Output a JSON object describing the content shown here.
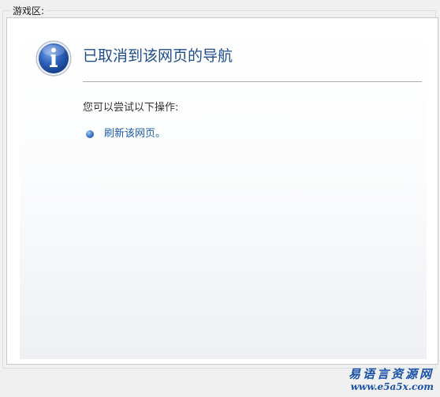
{
  "group_box": {
    "label": "游戏区:"
  },
  "error_page": {
    "icon": "info-icon",
    "title": "已取消到该网页的导航",
    "suggestion": "您可以尝试以下操作:",
    "actions": [
      {
        "label": "刷新该网页。"
      }
    ]
  },
  "watermark": {
    "text": "易语言资源网",
    "url": "www.e5a5x.com"
  },
  "colors": {
    "title": "#1e4e8a",
    "link": "#1e5aa8",
    "rule": "#a8b0b8",
    "icon_blue": "#1d54a8"
  }
}
